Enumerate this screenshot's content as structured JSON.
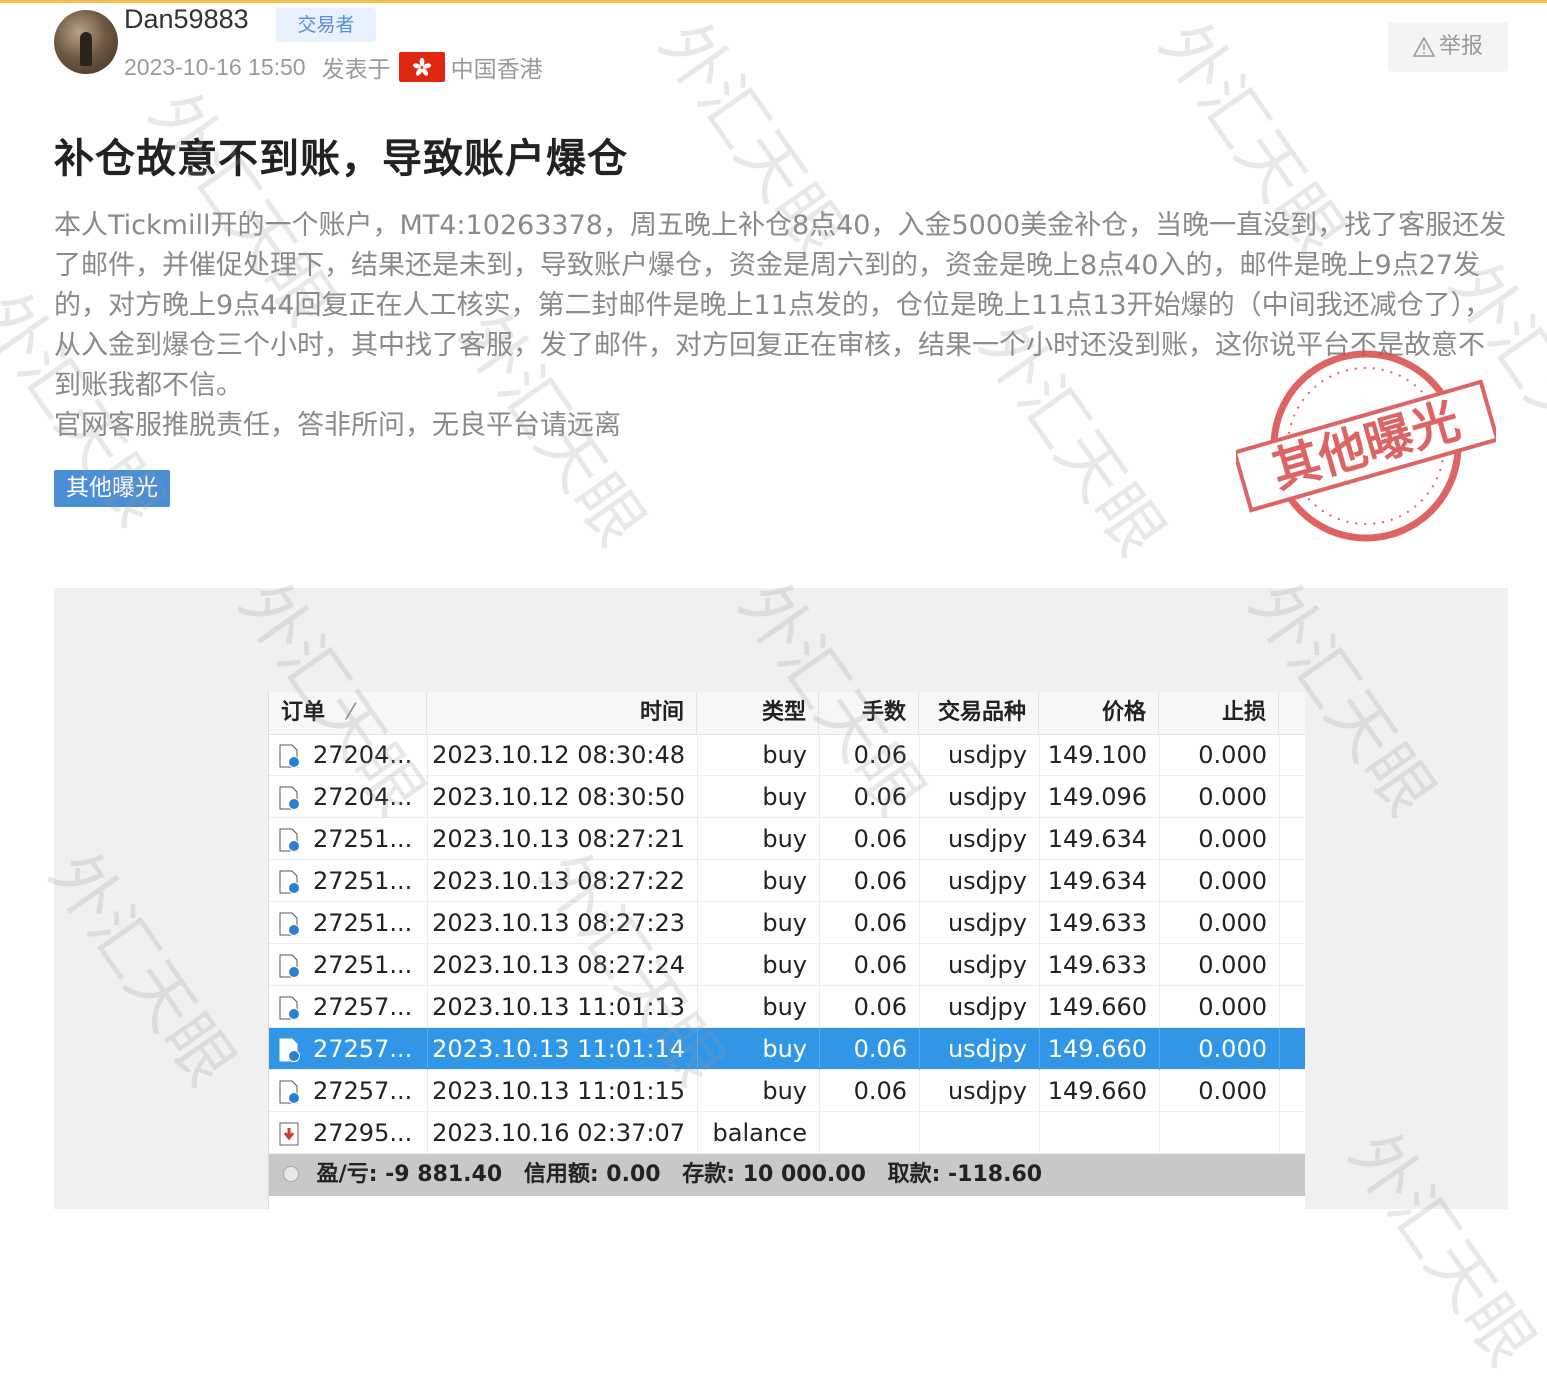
{
  "post": {
    "author": {
      "username": "Dan59883",
      "role": "交易者"
    },
    "datetime": "2023-10-16 15:50",
    "posted_in_label": "发表于",
    "location": "中国香港",
    "report_label": "举报",
    "title": "补仓故意不到账，导致账户爆仓",
    "paragraphs": [
      "本人Tickmill开的一个账户，MT4:10263378，周五晚上补仓8点40，入金5000美金补仓，当晚一直没到，找了客服还发了邮件，并催促处理下，结果还是未到，导致账户爆仓，资金是周六到的，资金是晚上8点40入的，邮件是晚上9点27发的，对方晚上9点44回复正在人工核实，第二封邮件是晚上11点发的，仓位是晚上11点13开始爆的（中间我还减仓了），从入金到爆仓三个小时，其中找了客服，发了邮件，对方回复正在审核，结果一个小时还没到账，这你说平台不是故意不到账我都不信。",
      "官网客服推脱责任，答非所问，无良平台请远离"
    ],
    "tag": "其他曝光",
    "stamp_text": "其他曝光",
    "watermark": "外汇天眼"
  },
  "terminal": {
    "columns": [
      "订单",
      "时间",
      "类型",
      "手数",
      "交易品种",
      "价格",
      "止损"
    ],
    "rows": [
      {
        "order": "27204...",
        "time": "2023.10.12 08:30:48",
        "type": "buy",
        "lots": "0.06",
        "symbol": "usdjpy",
        "price": "149.100",
        "sl": "0.000",
        "kind": "trade",
        "selected": false
      },
      {
        "order": "27204...",
        "time": "2023.10.12 08:30:50",
        "type": "buy",
        "lots": "0.06",
        "symbol": "usdjpy",
        "price": "149.096",
        "sl": "0.000",
        "kind": "trade",
        "selected": false
      },
      {
        "order": "27251...",
        "time": "2023.10.13 08:27:21",
        "type": "buy",
        "lots": "0.06",
        "symbol": "usdjpy",
        "price": "149.634",
        "sl": "0.000",
        "kind": "trade",
        "selected": false
      },
      {
        "order": "27251...",
        "time": "2023.10.13 08:27:22",
        "type": "buy",
        "lots": "0.06",
        "symbol": "usdjpy",
        "price": "149.634",
        "sl": "0.000",
        "kind": "trade",
        "selected": false
      },
      {
        "order": "27251...",
        "time": "2023.10.13 08:27:23",
        "type": "buy",
        "lots": "0.06",
        "symbol": "usdjpy",
        "price": "149.633",
        "sl": "0.000",
        "kind": "trade",
        "selected": false
      },
      {
        "order": "27251...",
        "time": "2023.10.13 08:27:24",
        "type": "buy",
        "lots": "0.06",
        "symbol": "usdjpy",
        "price": "149.633",
        "sl": "0.000",
        "kind": "trade",
        "selected": false
      },
      {
        "order": "27257...",
        "time": "2023.10.13 11:01:13",
        "type": "buy",
        "lots": "0.06",
        "symbol": "usdjpy",
        "price": "149.660",
        "sl": "0.000",
        "kind": "trade",
        "selected": false
      },
      {
        "order": "27257...",
        "time": "2023.10.13 11:01:14",
        "type": "buy",
        "lots": "0.06",
        "symbol": "usdjpy",
        "price": "149.660",
        "sl": "0.000",
        "kind": "trade",
        "selected": true
      },
      {
        "order": "27257...",
        "time": "2023.10.13 11:01:15",
        "type": "buy",
        "lots": "0.06",
        "symbol": "usdjpy",
        "price": "149.660",
        "sl": "0.000",
        "kind": "trade",
        "selected": false
      },
      {
        "order": "27295...",
        "time": "2023.10.16 02:37:07",
        "type": "balance",
        "lots": "",
        "symbol": "",
        "price": "",
        "sl": "",
        "kind": "balance",
        "selected": false
      }
    ],
    "footer": {
      "pnl": "盈/亏: -9 881.40",
      "credit": "信用额: 0.00",
      "deposit": "存款: 10 000.00",
      "withdraw": "取款: -118.60"
    }
  },
  "colors": {
    "accent_blue": "#4a8fd6",
    "selected_row": "#3296e8",
    "stamp_red": "#d94a4a",
    "flag_red": "#de2910"
  }
}
